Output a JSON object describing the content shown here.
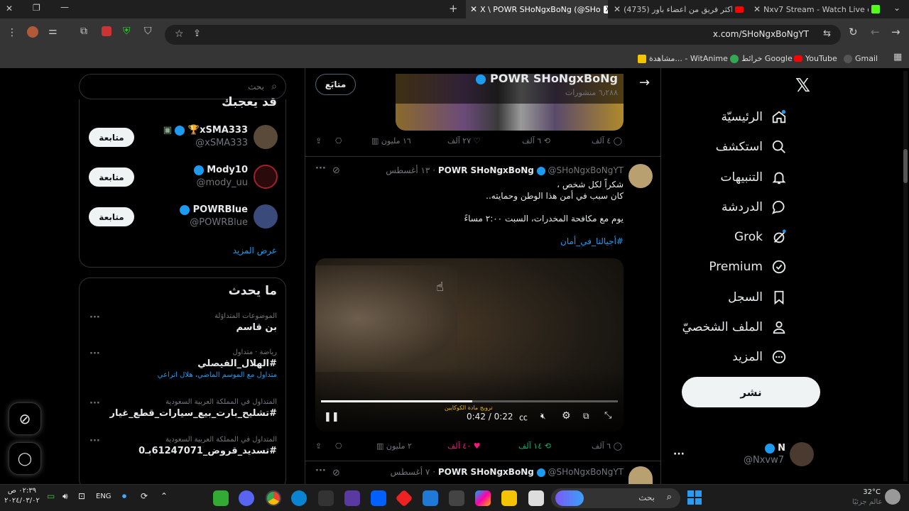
{
  "browser": {
    "tabs": [
      {
        "label": "X \\ POWR SHoNgxBoNg (@SHo"
      },
      {
        "label": "(4735) اكثر فريق من اعضاء باور"
      },
      {
        "label": "Nxv7 Stream - Watch Live on K"
      }
    ],
    "url": "x.com/SHoNgxBoNgYT",
    "bookmarks": [
      "Gmail",
      "YouTube",
      "خرائط Google",
      "مشاهدة... - WitAnime"
    ]
  },
  "nav": {
    "items": [
      "الرئيسيّة",
      "استكشف",
      "التنبيهات",
      "الدردشة",
      "Grok",
      "Premium",
      "السجل",
      "الملف الشخصيّ",
      "المزيد"
    ],
    "post_button": "نشر",
    "account": {
      "name": "N",
      "handle": "@Nxvw7"
    }
  },
  "header": {
    "name": "POWR SHoNgxBoNg",
    "posts": "٦٫٢٨٨ منشورات",
    "follow_label": "متابَع"
  },
  "tweet1": {
    "stats": {
      "replies": "٤ آلف",
      "retweets": "٦ آلف",
      "likes": "٢٧ آلف",
      "views": "١٦ مليون"
    }
  },
  "tweet2": {
    "name": "POWR SHoNgxBoNg",
    "handle": "@SHoNgxBoNgYT",
    "date": "· ١٣ أغسطس",
    "line1": "شكراً لكل شخص ،",
    "line2": "كان سبب في أمن هذا الوطن وحمايته..",
    "line3": "يوم مع مكافحة المخدرات، السبت ٢:٠٠ مساءً",
    "hashtag": "#أجيالنا_في_أمان",
    "video_caption": "ترويج مادة الكوكايين",
    "time": "0:42 / 0:22",
    "stats": {
      "replies": "٦ آلف",
      "retweets": "١٤ آلف",
      "likes": "٤٠ آلف",
      "views": "٢ مليون"
    }
  },
  "tweet3": {
    "name": "POWR SHoNgxBoNg",
    "handle": "@SHoNgxBoNgYT",
    "date": "· ٧ أغسطس"
  },
  "search": {
    "placeholder": "بحث"
  },
  "who_to_follow": {
    "title": "قد يعجبك",
    "users": [
      {
        "name": "xSMA333🏆",
        "handle": "@xSMA333",
        "button": "متابعة"
      },
      {
        "name": "Mody10",
        "handle": "@mody_uu",
        "button": "متابعة"
      },
      {
        "name": "POWRBlue",
        "handle": "@POWRBlue",
        "button": "متابعة"
      }
    ],
    "more": "عرض المزيد"
  },
  "trends": {
    "title": "ما يحدث",
    "items": [
      {
        "meta": "الموضوعات المتداوَلة",
        "name": "بن قاسم",
        "sub": ""
      },
      {
        "meta": "رياضة · متداول",
        "name": "#الهلال_الفيصلي",
        "sub": "متداول مع الموسم الماضي، هلال اتراعي"
      },
      {
        "meta": "المتداول في المملكة العربية السعودية",
        "name": "#تشليح_بارت_بيع_سيارات_قطع_غيار",
        "sub": ""
      },
      {
        "meta": "المتداول في المملكة العربية السعودية",
        "name": "#تسديد_قروض_61247071بـ0",
        "sub": ""
      }
    ]
  },
  "taskbar": {
    "weather_temp": "32°C",
    "weather_label": "عالم جزئيًا",
    "search": "بحث",
    "lang": "ENG",
    "time": "٠٢:٣٩ ص",
    "date": "٢٠٢٤/٠٣/٠٢"
  },
  "colors": {
    "accent": "#1d9bf0",
    "like": "#f91880",
    "retweet": "#00ba7c",
    "background": "#000000"
  }
}
